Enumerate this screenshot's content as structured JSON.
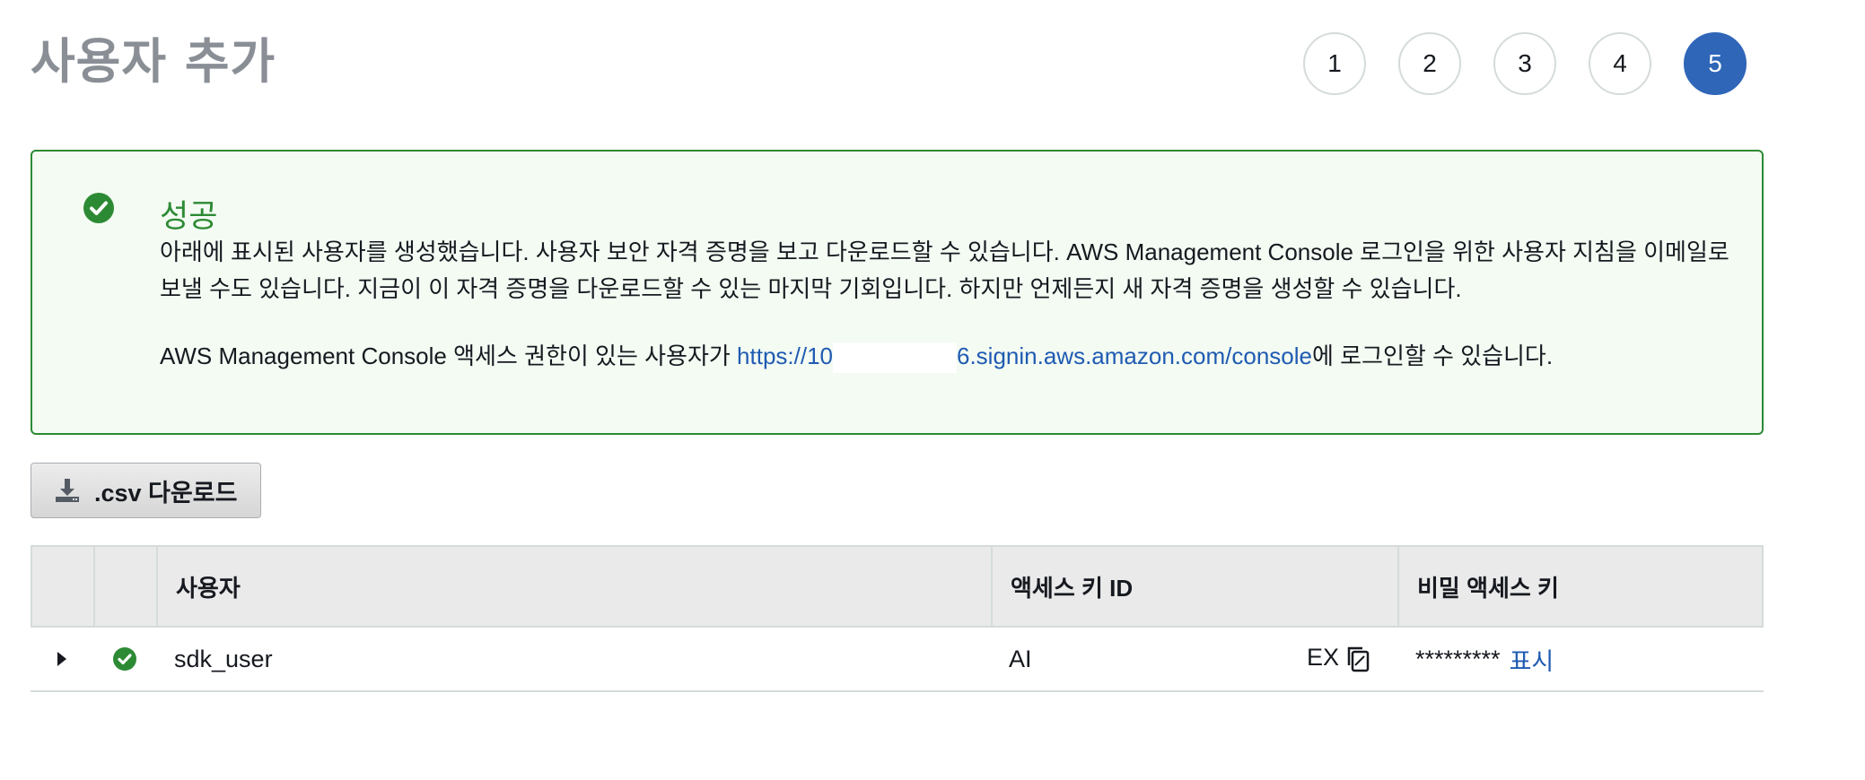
{
  "page": {
    "title": "사용자 추가"
  },
  "steps": [
    "1",
    "2",
    "3",
    "4",
    "5"
  ],
  "active_step": 5,
  "alert": {
    "title": "성공",
    "message": "아래에 표시된 사용자를 생성했습니다. 사용자 보안 자격 증명을 보고 다운로드할 수 있습니다. AWS Management Console 로그인을 위한 사용자 지침을 이메일로 보낼 수도 있습니다. 지금이 이 자격 증명을 다운로드할 수 있는 마지막 기회입니다. 하지만 언제든지 새 자격 증명을 생성할 수 있습니다.",
    "console_prefix": "AWS Management Console 액세스 권한이 있는 사용자가 ",
    "console_url_start": "https://10",
    "console_url_end": "6.signin.aws.amazon.com/console",
    "console_suffix": "에 로그인할 수 있습니다."
  },
  "csv_button": {
    "label": ".csv 다운로드"
  },
  "table": {
    "headers": [
      "",
      "",
      "사용자",
      "액세스 키 ID",
      "비밀 액세스 키"
    ],
    "rows": [
      {
        "user": "sdk_user",
        "access_key_start": "AI",
        "access_key_end": "EX",
        "secret_masked": "*********",
        "show_label": "표시"
      }
    ]
  },
  "colors": {
    "success": "#2d8a34",
    "active_step": "#2f66b8",
    "link": "#1f5bb2"
  }
}
